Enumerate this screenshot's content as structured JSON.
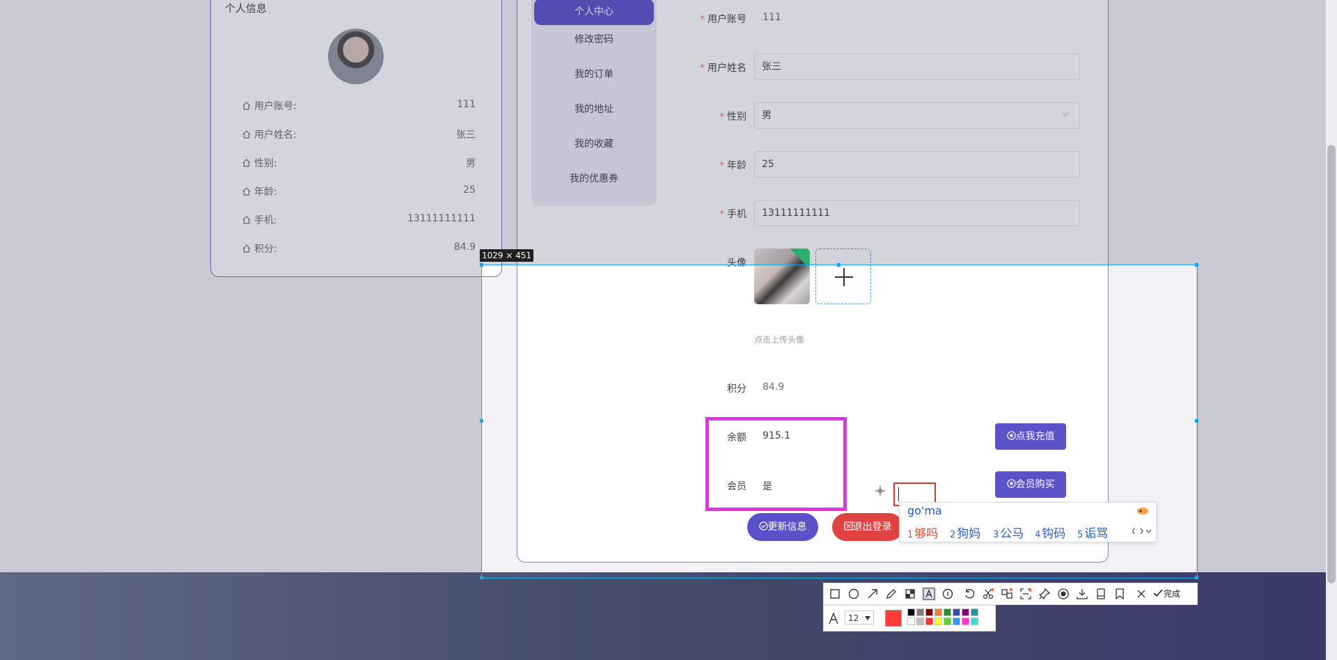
{
  "left_card": {
    "title": "个人信息",
    "rows": [
      {
        "label": "用户账号:",
        "value": "111"
      },
      {
        "label": "用户姓名:",
        "value": "张三"
      },
      {
        "label": "性别:",
        "value": "男"
      },
      {
        "label": "年龄:",
        "value": "25"
      },
      {
        "label": "手机:",
        "value": "13111111111"
      },
      {
        "label": "积分:",
        "value": "84.9"
      }
    ]
  },
  "menu": {
    "items": [
      "个人中心",
      "修改密码",
      "我的订单",
      "我的地址",
      "我的收藏",
      "我的优惠券"
    ],
    "active_index": 0
  },
  "form": {
    "account_label": "用户账号",
    "account_value": "111",
    "name_label": "用户姓名",
    "name_value": "张三",
    "gender_label": "性别",
    "gender_value": "男",
    "age_label": "年龄",
    "age_value": "25",
    "phone_label": "手机",
    "phone_value": "13111111111",
    "avatar_label": "头像",
    "upload_hint": "点击上传头像",
    "points_label": "积分",
    "points_value": "84.9",
    "balance_label": "余额",
    "balance_value": "915.1",
    "member_label": "会员",
    "member_value": "是",
    "recharge_button": "点我充值",
    "buy_member_button": "会员购买",
    "update_button": "更新信息",
    "logout_button": "退出登录"
  },
  "screenshot_tool": {
    "size_label": "1029 × 451",
    "done_label": "完成",
    "font_size": "12",
    "selected_color": "#ff3b3b",
    "highlight_color": "#e52ee6",
    "palette": [
      "#000000",
      "#808080",
      "#800000",
      "#f08030",
      "#2e8b2e",
      "#2f4fb0",
      "#800080",
      "#159aa0",
      "#ffffff",
      "#c0c0c0",
      "#ff3030",
      "#ffff33",
      "#66cc33",
      "#3399ff",
      "#ff33cc",
      "#33dddd"
    ]
  },
  "ime": {
    "input": "go'ma",
    "candidates": [
      {
        "num": "1",
        "text": "够吗"
      },
      {
        "num": "2",
        "text": "狗妈"
      },
      {
        "num": "3",
        "text": "公马"
      },
      {
        "num": "4",
        "text": "钩码"
      },
      {
        "num": "5",
        "text": "诟骂"
      }
    ]
  },
  "colors": {
    "primary": "#4b44c4",
    "danger": "#e03131",
    "selection": "#1aa3e6"
  }
}
